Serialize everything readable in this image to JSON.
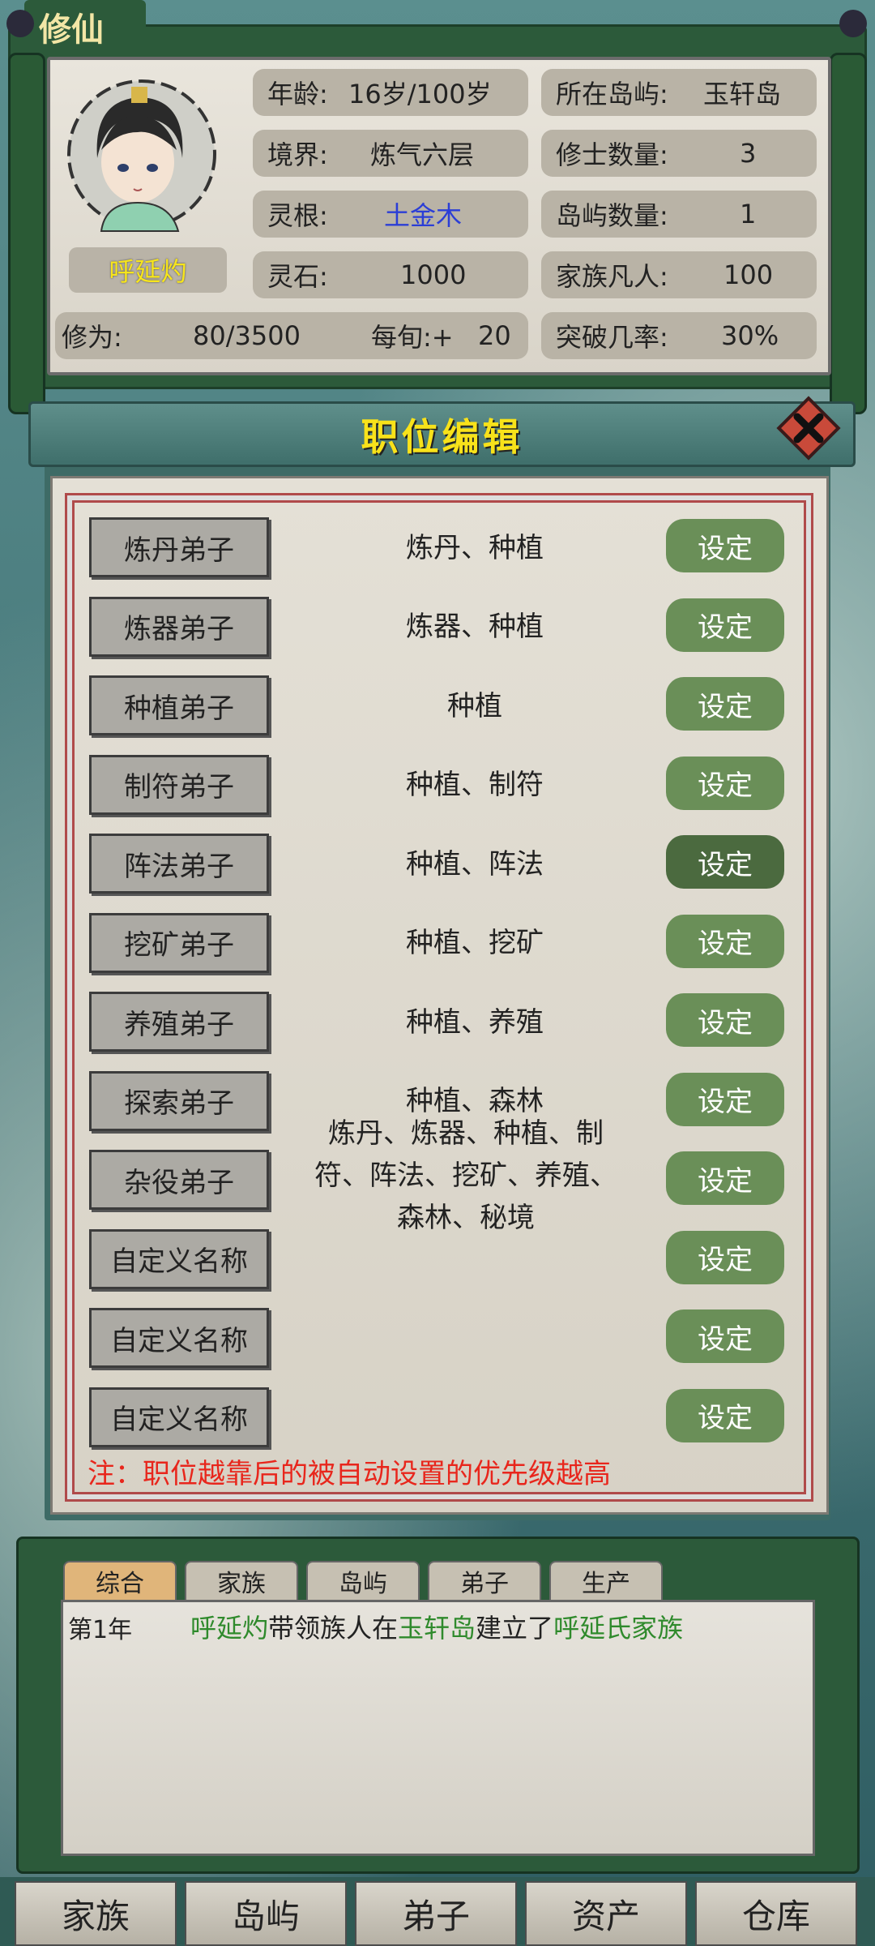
{
  "header": {
    "tab_title": "修仙",
    "character_name": "呼延灼",
    "stats": {
      "age_label": "年龄:",
      "age_value": "16岁/100岁",
      "realm_label": "境界:",
      "realm_value": "炼气六层",
      "root_label": "灵根:",
      "root_value": "土金木",
      "stone_label": "灵石:",
      "stone_value": "1000",
      "island_label": "所在岛屿:",
      "island_value": "玉轩岛",
      "cultivators_label": "修士数量:",
      "cultivators_value": "3",
      "islands_label": "岛屿数量:",
      "islands_value": "1",
      "mortals_label": "家族凡人:",
      "mortals_value": "100",
      "cultivation_label": "修为:",
      "cultivation_value": "80/3500",
      "per_turn_label": "每旬:+",
      "per_turn_value": "20",
      "breakthrough_label": "突破几率:",
      "breakthrough_value": "30%"
    },
    "colors": {
      "root_value": "#2b3ed6",
      "name": "#f7e51c"
    }
  },
  "modal": {
    "title": "职位编辑",
    "close_icon": "close-x-icon",
    "set_label": "设定",
    "rows": [
      {
        "name": "炼丹弟子",
        "duty": "炼丹、种植"
      },
      {
        "name": "炼器弟子",
        "duty": "炼器、种植"
      },
      {
        "name": "种植弟子",
        "duty": "种植"
      },
      {
        "name": "制符弟子",
        "duty": "种植、制符"
      },
      {
        "name": "阵法弟子",
        "duty": "种植、阵法"
      },
      {
        "name": "挖矿弟子",
        "duty": "种植、挖矿"
      },
      {
        "name": "养殖弟子",
        "duty": "种植、养殖"
      },
      {
        "name": "探索弟子",
        "duty": "种植、森林"
      },
      {
        "name": "杂役弟子",
        "duty": ""
      },
      {
        "name": "自定义名称",
        "duty": ""
      },
      {
        "name": "自定义名称",
        "duty": ""
      },
      {
        "name": "自定义名称",
        "duty": ""
      }
    ],
    "multi_duty_lines": [
      "炼丹、炼器、种植、制",
      "符、阵法、挖矿、养殖、",
      "森林、秘境"
    ],
    "note": "注：职位越靠后的被自动设置的优先级越高",
    "colors": {
      "note": "#e8261c",
      "set_button": "#6a8f58",
      "set_button_active": "#4b6a3f"
    }
  },
  "log": {
    "tabs": [
      "综合",
      "家族",
      "岛屿",
      "弟子",
      "生产"
    ],
    "active_tab": "综合",
    "entry_year": "第1年",
    "entry_parts": [
      "呼延灼",
      "带领族人在",
      "玉轩岛",
      "建立了",
      "呼延氏家族"
    ],
    "colors": {
      "highlight": "#2f8a2c"
    }
  },
  "bottom_nav": [
    "家族",
    "岛屿",
    "弟子",
    "资产",
    "仓库"
  ]
}
